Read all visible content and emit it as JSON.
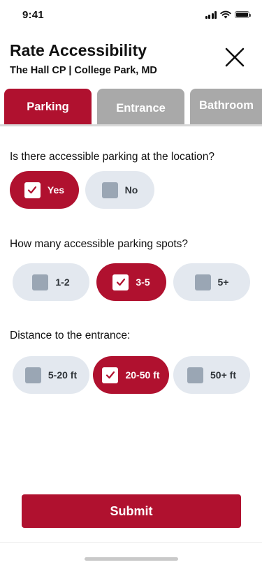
{
  "status_bar": {
    "time": "9:41",
    "signal_icon": "cellular-signal-icon",
    "wifi_icon": "wifi-icon",
    "battery_icon": "battery-icon"
  },
  "header": {
    "title": "Rate Accessibility",
    "subtitle": "The Hall CP | College Park, MD",
    "close_icon": "close-icon"
  },
  "tabs": [
    {
      "label": "Parking",
      "active": true
    },
    {
      "label": "Entrance",
      "active": false
    },
    {
      "label": "Bathroom",
      "active": false
    }
  ],
  "questions": [
    {
      "text": "Is there accessible parking at the location?",
      "options": [
        {
          "label": "Yes",
          "selected": true
        },
        {
          "label": "No",
          "selected": false
        }
      ]
    },
    {
      "text": "How many accessible parking spots?",
      "options": [
        {
          "label": "1-2",
          "selected": false
        },
        {
          "label": "3-5",
          "selected": true
        },
        {
          "label": "5+",
          "selected": false
        }
      ]
    },
    {
      "text": "Distance to the entrance:",
      "options": [
        {
          "label": "5-20 ft",
          "selected": false
        },
        {
          "label": "20-50 ft",
          "selected": true
        },
        {
          "label": "50+ ft",
          "selected": false
        }
      ]
    }
  ],
  "submit_label": "Submit",
  "colors": {
    "accent": "#b0112f",
    "inactive_tab": "#a9a9a9",
    "chip_unselected": "#e3e8ef",
    "checkbox_unselected": "#9aa6b4"
  }
}
